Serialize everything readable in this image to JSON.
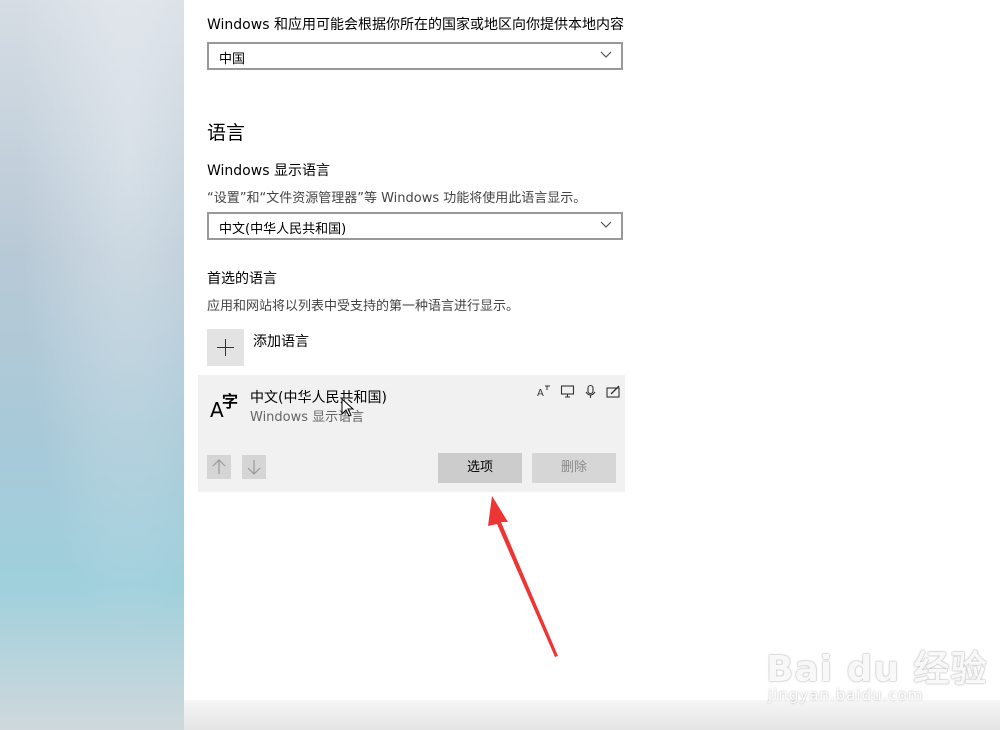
{
  "region": {
    "description": "Windows 和应用可能会根据你所在的国家或地区向你提供本地内容",
    "country_value": "中国"
  },
  "language": {
    "heading": "语言",
    "display_language_label": "Windows 显示语言",
    "display_language_desc": "“设置”和“文件资源管理器”等 Windows 功能将使用此语言显示。",
    "display_language_value": "中文(中华人民共和国)",
    "preferred_label": "首选的语言",
    "preferred_desc": "应用和网站将以列表中受支持的第一种语言进行显示。",
    "add_language_label": "添加语言",
    "item": {
      "name": "中文(中华人民共和国)",
      "subtitle": "Windows 显示语言",
      "glyph_a": "A",
      "glyph_zi": "字",
      "options_label": "选项",
      "delete_label": "删除"
    }
  },
  "watermark": {
    "main": "Bai du 经验",
    "sub": "jingyan.baidu.com"
  },
  "colors": {
    "annotation_arrow": "#ee3535"
  }
}
